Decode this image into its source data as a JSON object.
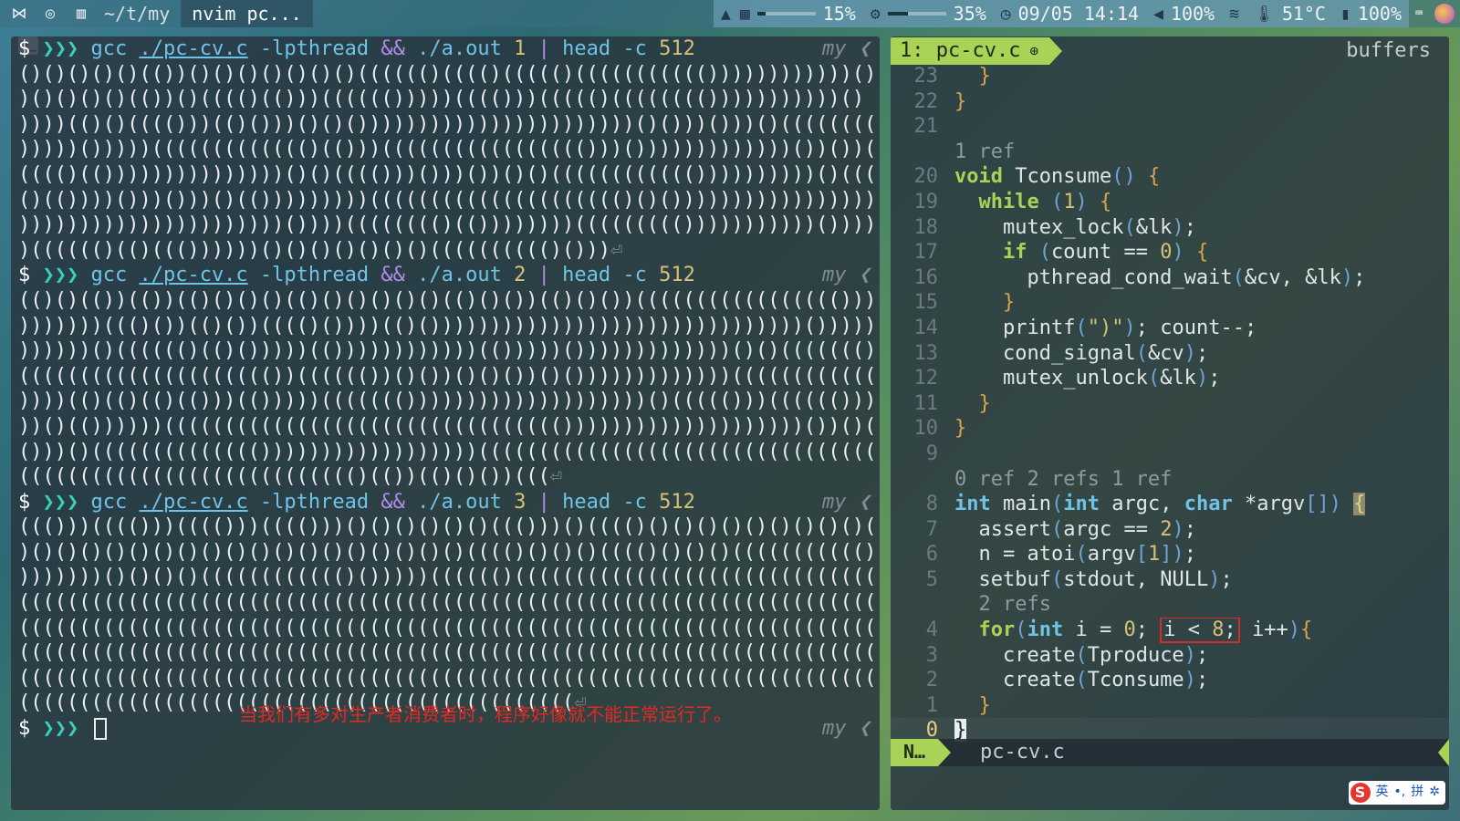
{
  "topbar": {
    "cwd": "~/t/my",
    "active_window": "nvim pc...",
    "volume_bar": 0.15,
    "volume_text": "15%",
    "cpu_bar": 0.35,
    "cpu_text": "35%",
    "datetime": "09/05 14:14",
    "sound_text": "100%",
    "temp_text": "51°C",
    "battery_text": "100%"
  },
  "terminal": {
    "prompt_dollar": "$",
    "prompt_arrows": "❯❯❯",
    "right_tag": "my ❮",
    "runs": [
      {
        "cmd_gcc": "gcc",
        "cmd_path": "./pc-cv.c",
        "cmd_flag": "-lpthread",
        "cmd_and": "&&",
        "cmd_exec": "./a.out",
        "cmd_arg": "1",
        "cmd_pipe": "|",
        "cmd_head": "head -c",
        "cmd_bytes": "512",
        "output": [
          "()()()()()(())()()()()()()()(((((()(((()((((()((((((((((())))))))))))()",
          ")()()()()(())()(((()(()))(((((()))))(((()))((((()(((((((()))))))))))()",
          "))))(()()(((()))(()()))()()()))))))))))))))))))))))()()))()))()((((((((()",
          ")))))()))))((((((((((((()(()))((((((((((((((((()))()))))))))))))())())(((",
          "(((()(()))))))))))))))()()(((()))()))())()()(((((((((((())))))))))()(((",
          "()(())))()))()))()(()))))))))((((((((((((((((((((()()()))))))))))))))))))",
          "))))))))))))))))))))))())))(((((((()(())))))))((((((((()))))))))))()))))",
          ")(((((()(()((())))))()()()()()()()(((((((((()()))"
        ]
      },
      {
        "cmd_gcc": "gcc",
        "cmd_path": "./pc-cv.c",
        "cmd_flag": "-lpthread",
        "cmd_and": "&&",
        "cmd_exec": "./a.out",
        "cmd_arg": "2",
        "cmd_pipe": "|",
        "cmd_head": "head -c",
        "cmd_bytes": "512",
        "output": [
          "(()()(())(())(()()()()(()()()()()()(()()())(()()())((((((((((((((((()))))",
          ")))))))((()())(()())(((()())))(()()))))))))))))))))))))))))))))))())))))",
          "))))))()(((((()(()()))))(())))))))))))(()))))()))))))))))))()()((((((()",
          "((((((((((((((((((((())(((((())()())()()())()()))))))))))))(((((((((((((()))",
          "))))(()(()(()(()))(()))))((((((())))))))))))))))))))()((((()))(((((()))",
          "))()(())))))((((((((((((((((((((((((((((((((())))))))))))))))))))())()(",
          "()))()(((((((((((((())))))))))))))))))(((((((((((((((((((((((((((((((((((((",
          "(((((((((((((((((((((((((((()(())(()()())((("
        ]
      },
      {
        "cmd_gcc": "gcc",
        "cmd_path": "./pc-cv.c",
        "cmd_flag": "-lpthread",
        "cmd_and": "&&",
        "cmd_exec": "./a.out",
        "cmd_arg": "3",
        "cmd_pipe": "|",
        "cmd_head": "head -c",
        "cmd_bytes": "512",
        "output": [
          "((()))(((()))(((()))(((()))()()()()()()((()))()(((()()()()()()()()()()()()(",
          ")()()()()()()()()()()()()()()()()()()(((()()()()(((()()()()((((((((((()",
          ")))))))()()()()(((((((((((()()))))(((((()((((((((((((((((((((((((((((((((((",
          "((((((((((((((((((((((((((((((((((((((((((((((((((((((((((((((((((((((((((((",
          "((((((((((((((((((((((((((((((((((((((((((((((((((((((((((((((((((((((((((((",
          "((((((((((((((((((((((((((((((((((((((((((((((((((((((((((((((((((((((((((((",
          "((((((((((((((((((((((((((((((((((((((((((((((((((((((((((((((((((((((((((((",
          "(((((((((((((((((((((((((((((((((((((((((((((("
        ]
      }
    ],
    "eol_mark": "⏎",
    "note": "当我们有多对生产者消费者时，程序好像就不能正常运行了。"
  },
  "nvim": {
    "tab_label": "1: pc-cv.c",
    "tab_icon": "⊕",
    "buffers_label": "buffers",
    "mode": "N…",
    "status_file": "pc-cv.c",
    "lines": [
      {
        "n": "23",
        "t": "  }"
      },
      {
        "n": "22",
        "t": "}"
      },
      {
        "n": "21",
        "t": ""
      },
      {
        "n": "",
        "t": "1 ref"
      },
      {
        "n": "20",
        "t": "void Tconsume() {"
      },
      {
        "n": "19",
        "t": "  while (1) {"
      },
      {
        "n": "18",
        "t": "    mutex_lock(&lk);"
      },
      {
        "n": "17",
        "t": "    if (count == 0) {"
      },
      {
        "n": "16",
        "t": "      pthread_cond_wait(&cv, &lk);"
      },
      {
        "n": "15",
        "t": "    }"
      },
      {
        "n": "14",
        "t": "    printf(\")\"); count--;"
      },
      {
        "n": "13",
        "t": "    cond_signal(&cv);"
      },
      {
        "n": "12",
        "t": "    mutex_unlock(&lk);"
      },
      {
        "n": "11",
        "t": "  }"
      },
      {
        "n": "10",
        "t": "}"
      },
      {
        "n": "9",
        "t": ""
      },
      {
        "n": "",
        "t": "0 ref 2 refs 1 ref"
      },
      {
        "n": "8",
        "t": "int main(int argc, char *argv[]) {"
      },
      {
        "n": "7",
        "t": "  assert(argc == 2);"
      },
      {
        "n": "6",
        "t": "  n = atoi(argv[1]);"
      },
      {
        "n": "5",
        "t": "  setbuf(stdout, NULL);"
      },
      {
        "n": "",
        "t": "  2 refs"
      },
      {
        "n": "4",
        "t": "  for(int i = 0; i < 8; i++){"
      },
      {
        "n": "3",
        "t": "    create(Tproduce);"
      },
      {
        "n": "2",
        "t": "    create(Tconsume);"
      },
      {
        "n": "1",
        "t": "  }"
      },
      {
        "n": "0",
        "t": "}"
      }
    ]
  },
  "ime": {
    "badge": "S",
    "lang": "英",
    "punct": "•,",
    "mode": "拼",
    "gear": "✲"
  },
  "colors": {
    "accent_green": "#a9d356",
    "keyword_green": "#a9d356",
    "type_blue": "#6fc3e6",
    "number_yellow": "#d6c176",
    "highlight_red": "#d62b26",
    "note_red": "#e02a22"
  }
}
